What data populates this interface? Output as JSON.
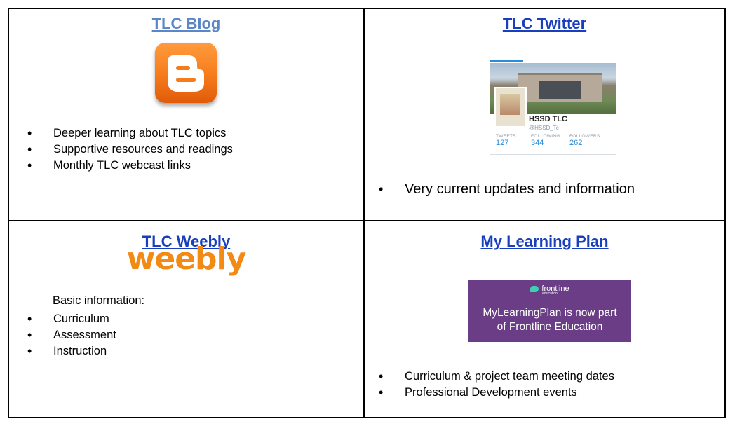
{
  "cells": {
    "blog": {
      "title": "TLC Blog",
      "bullets": [
        "Deeper learning about TLC topics",
        "Supportive resources and readings",
        "Monthly TLC webcast links"
      ]
    },
    "twitter": {
      "title": "TLC Twitter",
      "card": {
        "name": "HSSD TLC",
        "handle": "@HSSD_Tc",
        "stats": [
          {
            "label": "TWEETS",
            "value": "127"
          },
          {
            "label": "FOLLOWING",
            "value": "344"
          },
          {
            "label": "FOLLOWERS",
            "value": "262"
          }
        ]
      },
      "bullets": [
        "Very current updates and information"
      ]
    },
    "weebly": {
      "title": "TLC Weebly",
      "logo_text": "weebly",
      "intro": "Basic information:",
      "bullets": [
        "Curriculum",
        "Assessment",
        "Instruction"
      ]
    },
    "mlp": {
      "title": "My Learning Plan",
      "banner": {
        "logo_text": "frontline",
        "logo_sub": "education",
        "line1": "MyLearningPlan is now part",
        "line2": "of Frontline Education"
      },
      "bullets": [
        "Curriculum & project team meeting dates",
        "Professional Development events"
      ]
    }
  },
  "colors": {
    "blog_title": "#5b87c6",
    "link_title": "#1a3fbd",
    "blogger_orange": "#f57b1b",
    "weebly_orange": "#f28a14",
    "frontline_purple": "#6a3d86",
    "twitter_blue": "#2a8bd7"
  }
}
